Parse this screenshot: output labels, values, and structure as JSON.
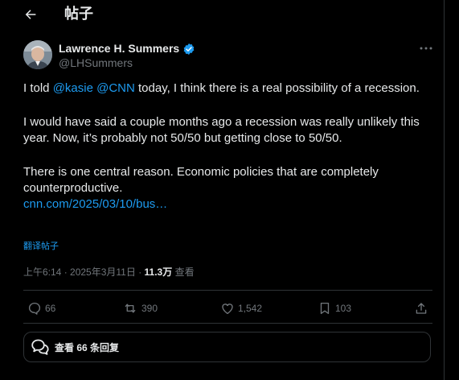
{
  "header": {
    "title": "帖子"
  },
  "author": {
    "name": "Lawrence H. Summers",
    "handle": "@LHSummers",
    "verified": true
  },
  "tweet": {
    "p1_pre": "I told ",
    "p1_mention1": "@kasie",
    "p1_sep": " ",
    "p1_mention2": "@CNN",
    "p1_post": " today, I think there is a real possibility of a recession.",
    "p2": "I would have said a couple months ago a recession was really unlikely this year. Now, it’s probably not 50/50 but getting close to 50/50.",
    "p3": "There is one central reason. Economic policies that are completely counterproductive.",
    "link": "cnn.com/2025/03/10/bus…",
    "translate": "翻译帖子"
  },
  "meta": {
    "time": "上午6:14",
    "sep1": " · ",
    "date": "2025年3月11日",
    "sep2": " · ",
    "views": "11.3万",
    "views_label": " 查看"
  },
  "actions": {
    "replies": "66",
    "reposts": "390",
    "likes": "1,542",
    "bookmarks": "103"
  },
  "replies_button": {
    "label": "查看 66 条回复"
  },
  "colors": {
    "accent": "#1d9bf0",
    "muted": "#71767b",
    "text": "#e7e9ea",
    "bg": "#000000"
  }
}
